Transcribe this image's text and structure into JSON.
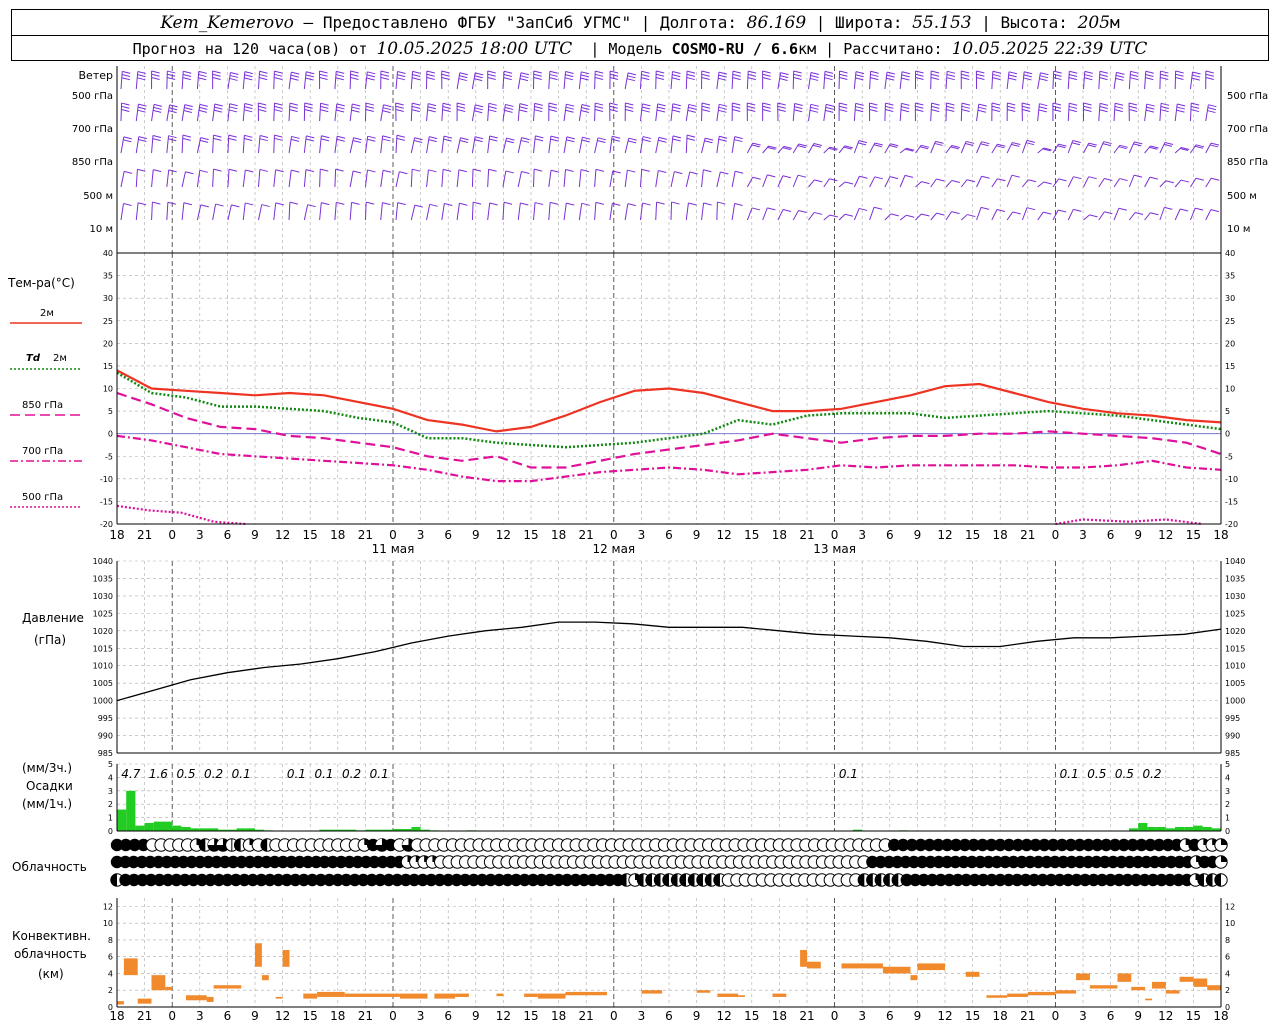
{
  "header": {
    "station": "Kem_Kemerovo",
    "provider": " — Предоставлено ФГБУ \"ЗапСиб УГМС\" | Долгота: ",
    "lon": "86.169",
    "lat_label": " | Широта: ",
    "lat": "55.153",
    "alt_label": " | Высота: ",
    "alt": "205",
    "alt_unit": "м",
    "forecast_label": "Прогноз на 120 часа(ов) от ",
    "forecast_from": "10.05.2025 18:00 UTC",
    "model_label": "  | Модель ",
    "model": "COSMO-RU / 6.6",
    "model_unit": "км",
    "calc_label": " | Рассчитано: ",
    "calc_time": "10.05.2025 22:39 UTC"
  },
  "labels": {
    "wind": "Ветер",
    "wind_levels": [
      "500 гПа",
      "700 гПа",
      "850 гПа",
      "500 м",
      "10   м"
    ],
    "temp": "Тем-ра(°C)",
    "legend_2m": "2м",
    "legend_td": "Td",
    "legend_td2": "2м",
    "legend_850": "850 гПа",
    "legend_700": "700 гПа",
    "legend_500": "500 гПа",
    "pressure": "Давление",
    "pressure_unit": "(гПа)",
    "precip_unit3": "(мм/3ч.)",
    "precip": "Осадки",
    "precip_unit1": "(мм/1ч.)",
    "cloud": "Облачность",
    "conv1": "Конвективн.",
    "conv2": "облачность",
    "conv3": "(км)"
  },
  "colors": {
    "wind": "#7b2fd6",
    "t2m": "#ee3322",
    "td2m": "#118811",
    "t850": "#e0109a",
    "t700": "#e0109a",
    "t500": "#e0109a",
    "pressure": "#000000",
    "precip": "#22cc22",
    "conv": "#f08a2c"
  },
  "chart_data": {
    "type": "line",
    "x_ticks": [
      "18",
      "21",
      "0",
      "3",
      "6",
      "9",
      "12",
      "15",
      "18",
      "21",
      "0",
      "3",
      "6",
      "9",
      "12",
      "15",
      "18",
      "21",
      "0",
      "3",
      "6",
      "9",
      "12",
      "15",
      "18",
      "21",
      "0"
    ],
    "dates": [
      "11 мая",
      "12 мая",
      "13 мая"
    ],
    "temperature": {
      "ylim": [
        -20,
        40
      ],
      "yticks": [
        40,
        35,
        30,
        25,
        20,
        15,
        10,
        5,
        0,
        -5,
        -10,
        -15,
        -20
      ],
      "hours": [
        0,
        3,
        6,
        9,
        12,
        15,
        18,
        21,
        24,
        27,
        30,
        33,
        36,
        39,
        42,
        45,
        48,
        51,
        54,
        57,
        60,
        63,
        66,
        69,
        72,
        75,
        78,
        81,
        84,
        87,
        90,
        93,
        96,
        99,
        102,
        105,
        108,
        111,
        114,
        117,
        120
      ],
      "series": [
        {
          "name": "2м",
          "values": [
            14,
            10,
            9.5,
            9,
            8.5,
            9,
            8.5,
            7,
            5.5,
            3,
            2,
            0.5,
            1.5,
            4,
            7,
            9.5,
            10,
            9,
            7,
            5,
            5,
            5.5,
            7,
            8.5,
            10.5,
            11,
            9,
            7,
            5.5,
            4.5,
            4,
            3,
            2.5
          ]
        },
        {
          "name": "Td 2м",
          "values": [
            13.5,
            9,
            8,
            6,
            6,
            5.5,
            5,
            3.5,
            2.5,
            -1,
            -1,
            -2,
            -2.5,
            -3,
            -2.5,
            -2,
            -1,
            0,
            3,
            2,
            4,
            4.5,
            4.5,
            4.5,
            3.5,
            4,
            4.5,
            5,
            4.5,
            4,
            3,
            2,
            1
          ]
        },
        {
          "name": "850 гПа",
          "values": [
            9,
            6.5,
            3.5,
            1.5,
            1,
            -0.5,
            -1,
            -2,
            -3,
            -5,
            -6,
            -5,
            -7.5,
            -7.5,
            -6,
            -4.5,
            -3.5,
            -2.5,
            -1.5,
            0,
            -1,
            -2,
            -1,
            -0.5,
            -0.5,
            0,
            0,
            0.5,
            0,
            -0.5,
            -1,
            -2,
            -4.5
          ]
        },
        {
          "name": "700 гПа",
          "values": [
            -0.5,
            -1.5,
            -3,
            -4.5,
            -5,
            -5.5,
            -6,
            -6.5,
            -7,
            -8,
            -9.5,
            -10.5,
            -10.5,
            -9.5,
            -8.5,
            -8,
            -7.5,
            -8,
            -9,
            -8.5,
            -8,
            -7,
            -7.5,
            -7,
            -7,
            -7,
            -7,
            -7.5,
            -7.5,
            -7,
            -6,
            -7.5,
            -8
          ]
        },
        {
          "name": "500 гПа",
          "values": [
            -16,
            -17,
            -17.5,
            -19.5,
            -20
          ]
        }
      ]
    },
    "pressure": {
      "ylim": [
        985,
        1040
      ],
      "yticks": [
        1040,
        1035,
        1030,
        1025,
        1020,
        1015,
        1010,
        1005,
        1000,
        995,
        990,
        985
      ],
      "values": [
        1000,
        1003,
        1006,
        1008,
        1009.5,
        1010.5,
        1012,
        1014,
        1016.5,
        1018.5,
        1020,
        1021,
        1022.5,
        1022.5,
        1022,
        1021,
        1021,
        1021,
        1020,
        1019,
        1018.5,
        1018,
        1017,
        1015.5,
        1015.5,
        1017,
        1018,
        1018,
        1018.5,
        1019,
        1020.5
      ]
    },
    "precip": {
      "ylim": [
        0,
        5
      ],
      "yticks": [
        5,
        4,
        3,
        2,
        1,
        0
      ],
      "totals_3h": [
        {
          "hour": 1,
          "label": "4.7"
        },
        {
          "hour": 4,
          "label": "1.6"
        },
        {
          "hour": 7,
          "label": "0.5"
        },
        {
          "hour": 10,
          "label": "0.2"
        },
        {
          "hour": 13,
          "label": "0.1"
        },
        {
          "hour": 19,
          "label": "0.1"
        },
        {
          "hour": 22,
          "label": "0.1"
        },
        {
          "hour": 25,
          "label": "0.2"
        },
        {
          "hour": 28,
          "label": "0.1"
        },
        {
          "hour": 79,
          "label": "0.1"
        },
        {
          "hour": 103,
          "label": "0.1"
        },
        {
          "hour": 106,
          "label": "0.5"
        },
        {
          "hour": 109,
          "label": "0.5"
        },
        {
          "hour": 112,
          "label": "0.2"
        }
      ],
      "hourly": [
        1.6,
        3,
        0.4,
        0.6,
        0.7,
        0.7,
        0.4,
        0.3,
        0.2,
        0.2,
        0.2,
        0.1,
        0.1,
        0.2,
        0.2,
        0.1,
        0.05,
        0,
        0,
        0,
        0,
        0,
        0.1,
        0.1,
        0.1,
        0.1,
        0.05,
        0.1,
        0.1,
        0.1,
        0.15,
        0.15,
        0.3,
        0.1,
        0.05,
        0,
        0,
        0,
        0.05,
        0,
        0,
        0,
        0,
        0,
        0,
        0,
        0,
        0,
        0,
        0,
        0,
        0,
        0,
        0,
        0,
        0,
        0,
        0,
        0,
        0,
        0,
        0,
        0,
        0,
        0,
        0,
        0,
        0,
        0,
        0,
        0,
        0,
        0,
        0,
        0,
        0,
        0,
        0,
        0,
        0,
        0.1,
        0,
        0,
        0,
        0,
        0.05,
        0,
        0,
        0,
        0,
        0,
        0,
        0,
        0,
        0,
        0,
        0,
        0,
        0,
        0,
        0,
        0,
        0,
        0,
        0,
        0,
        0,
        0,
        0,
        0,
        0.2,
        0.6,
        0.3,
        0.3,
        0.2,
        0.3,
        0.3,
        0.4,
        0.3,
        0.2,
        0.2,
        0.15,
        0.1,
        0.05,
        0,
        0
      ]
    },
    "clouds": {
      "rows": [
        "FFFFEEEEEQHTTRHQEHEEEEEEEEEEQFTFETEEEEEEEEEEEEEEEEEEEEEEEEEEEEEEEEEEEEEEEEEEEEEEEEEEEEEEFFFFFFFFFFFFFFFFFFFFFFFFFFFFFFFFFQFQQQ",
        "FFFFFFFFFFFFFFFFFFFFFFFFFFFFFFFFFFFQQQQEEEEEEEEEEEEEEEEEEEEEEEEEEEEEEEEEEEEEEEEEEEEEEEEEEEEFFFFFFFFFFFFFFFFFFFFFFFFFFFFFFFFFFFFFFFQFFQ",
        "HFFFFFFFFFFFFFFFFFFFFFFFFFFFFFFFFFFFFFFFFFFFFFFFFFFFFFFFFFFFHQHHHHHHHHHHEEEEEEEEEEEEEEEEHHHHHFFFFFFFFFFFFFFFFFFFFFFFFFFFFFFFFFFQHHH"
      ]
    },
    "convective": {
      "ylim": [
        0,
        13
      ],
      "yticks": [
        12,
        10,
        8,
        6,
        4,
        2,
        0
      ],
      "bars": [
        {
          "h0": 0,
          "h1": 1,
          "lo": 0.3,
          "hi": 0.7
        },
        {
          "h0": 1,
          "h1": 3,
          "lo": 3.8,
          "hi": 5.8
        },
        {
          "h0": 3,
          "h1": 5,
          "lo": 0.4,
          "hi": 1
        },
        {
          "h0": 5,
          "h1": 7,
          "lo": 2,
          "hi": 3.8
        },
        {
          "h0": 7,
          "h1": 8,
          "lo": 2,
          "hi": 2.4
        },
        {
          "h0": 10,
          "h1": 13,
          "lo": 0.8,
          "hi": 1.4
        },
        {
          "h0": 13,
          "h1": 14,
          "lo": 0.6,
          "hi": 1.2
        },
        {
          "h0": 14,
          "h1": 18,
          "lo": 2.2,
          "hi": 2.6
        },
        {
          "h0": 20,
          "h1": 21,
          "lo": 4.8,
          "hi": 7.6
        },
        {
          "h0": 21,
          "h1": 22,
          "lo": 3.2,
          "hi": 3.8
        },
        {
          "h0": 23,
          "h1": 24,
          "lo": 1,
          "hi": 1.2
        },
        {
          "h0": 24,
          "h1": 25,
          "lo": 4.8,
          "hi": 6.8
        },
        {
          "h0": 27,
          "h1": 29,
          "lo": 1,
          "hi": 1.6
        },
        {
          "h0": 29,
          "h1": 33,
          "lo": 1.2,
          "hi": 1.8
        },
        {
          "h0": 33,
          "h1": 41,
          "lo": 1.2,
          "hi": 1.6
        },
        {
          "h0": 41,
          "h1": 45,
          "lo": 1,
          "hi": 1.6
        },
        {
          "h0": 46,
          "h1": 49,
          "lo": 1,
          "hi": 1.6
        },
        {
          "h0": 49,
          "h1": 51,
          "lo": 1.2,
          "hi": 1.6
        },
        {
          "h0": 55,
          "h1": 56,
          "lo": 1.3,
          "hi": 1.6
        },
        {
          "h0": 59,
          "h1": 61,
          "lo": 1.2,
          "hi": 1.6
        },
        {
          "h0": 61,
          "h1": 65,
          "lo": 1,
          "hi": 1.6
        },
        {
          "h0": 65,
          "h1": 71,
          "lo": 1.4,
          "hi": 1.8
        },
        {
          "h0": 76,
          "h1": 79,
          "lo": 1.6,
          "hi": 2
        },
        {
          "h0": 84,
          "h1": 86,
          "lo": 1.7,
          "hi": 2
        },
        {
          "h0": 87,
          "h1": 90,
          "lo": 1.2,
          "hi": 1.6
        },
        {
          "h0": 90,
          "h1": 91,
          "lo": 1.2,
          "hi": 1.4
        },
        {
          "h0": 95,
          "h1": 97,
          "lo": 1.2,
          "hi": 1.6
        },
        {
          "h0": 99,
          "h1": 100,
          "lo": 4.8,
          "hi": 6.8
        },
        {
          "h0": 100,
          "h1": 102,
          "lo": 4.6,
          "hi": 5.4
        },
        {
          "h0": 105,
          "h1": 111,
          "lo": 4.6,
          "hi": 5.2
        },
        {
          "h0": 111,
          "h1": 115,
          "lo": 4,
          "hi": 4.8
        },
        {
          "h0": 115,
          "h1": 116,
          "lo": 3.2,
          "hi": 3.8
        },
        {
          "h0": 116,
          "h1": 120,
          "lo": 4.4,
          "hi": 5.2
        },
        {
          "h0": 123,
          "h1": 125,
          "lo": 3.6,
          "hi": 4.2
        },
        {
          "h0": 126,
          "h1": 129,
          "lo": 1.1,
          "hi": 1.4
        },
        {
          "h0": 129,
          "h1": 132,
          "lo": 1.2,
          "hi": 1.6
        },
        {
          "h0": 132,
          "h1": 136,
          "lo": 1.4,
          "hi": 1.8
        },
        {
          "h0": 136,
          "h1": 139,
          "lo": 1.6,
          "hi": 2
        },
        {
          "h0": 139,
          "h1": 141,
          "lo": 3.2,
          "hi": 4
        },
        {
          "h0": 141,
          "h1": 145,
          "lo": 2.2,
          "hi": 2.6
        },
        {
          "h0": 145,
          "h1": 147,
          "lo": 3,
          "hi": 4
        },
        {
          "h0": 147,
          "h1": 149,
          "lo": 2,
          "hi": 2.4
        },
        {
          "h0": 149,
          "h1": 150,
          "lo": 0.8,
          "hi": 1
        },
        {
          "h0": 150,
          "h1": 152,
          "lo": 2.2,
          "hi": 3
        },
        {
          "h0": 152,
          "h1": 154,
          "lo": 1.6,
          "hi": 2
        },
        {
          "h0": 154,
          "h1": 156,
          "lo": 3,
          "hi": 3.6
        },
        {
          "h0": 156,
          "h1": 158,
          "lo": 2.4,
          "hi": 3.4
        },
        {
          "h0": 158,
          "h1": 160,
          "lo": 2,
          "hi": 2.6
        }
      ]
    }
  }
}
